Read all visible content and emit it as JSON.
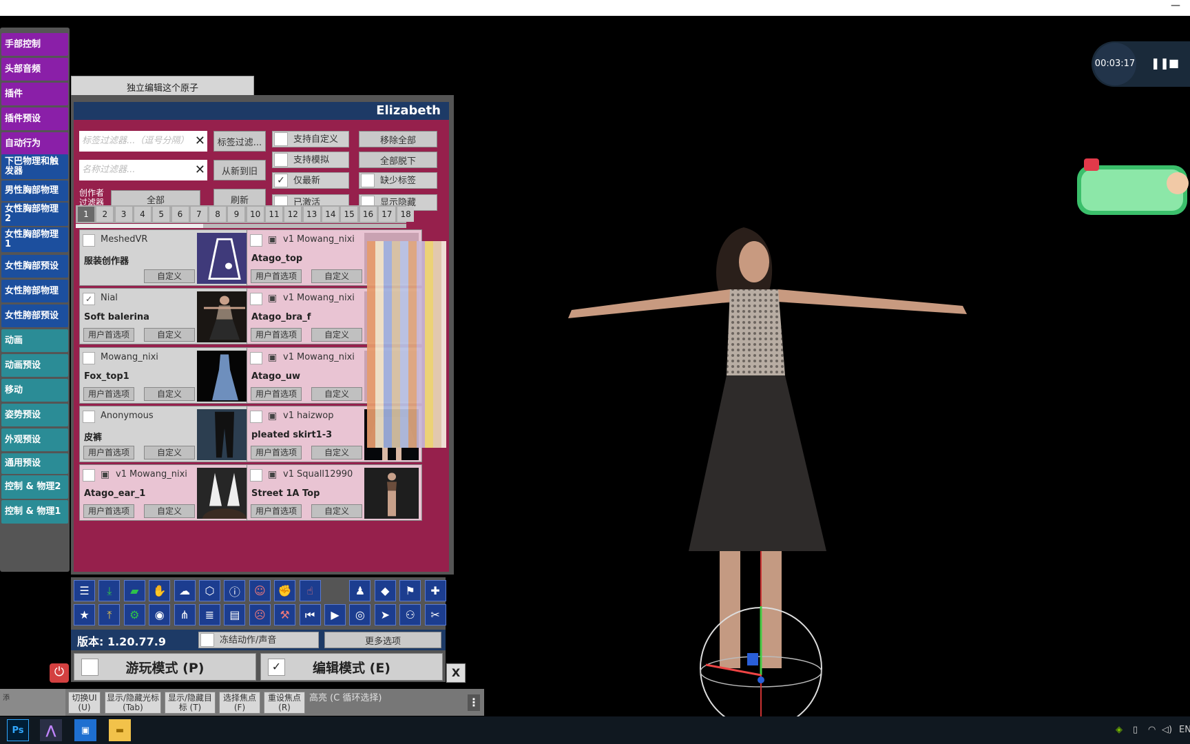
{
  "side_menu": {
    "items": [
      {
        "label": "手部控制",
        "color": "purple"
      },
      {
        "label": "头部音频",
        "color": "purple"
      },
      {
        "label": "插件",
        "color": "purple"
      },
      {
        "label": "插件预设",
        "color": "purple"
      },
      {
        "label": "自动行为",
        "color": "purple"
      },
      {
        "label": "下巴物理和触发器",
        "color": "blue"
      },
      {
        "label": "男性胸部物理",
        "color": "blue"
      },
      {
        "label": "女性胸部物理2",
        "color": "blue"
      },
      {
        "label": "女性胸部物理1",
        "color": "blue"
      },
      {
        "label": "女性胸部预设",
        "color": "blue"
      },
      {
        "label": "女性胯部物理",
        "color": "blue"
      },
      {
        "label": "女性胯部预设",
        "color": "blue"
      },
      {
        "label": "动画",
        "color": "teal"
      },
      {
        "label": "动画预设",
        "color": "teal"
      },
      {
        "label": "移动",
        "color": "teal"
      },
      {
        "label": "姿势预设",
        "color": "teal"
      },
      {
        "label": "外观预设",
        "color": "teal"
      },
      {
        "label": "通用预设",
        "color": "teal"
      },
      {
        "label": "控制 & 物理2",
        "color": "teal"
      },
      {
        "label": "控制 & 物理1",
        "color": "teal"
      }
    ]
  },
  "atom_edit_button": "独立编辑这个原子",
  "panel": {
    "title": "Elizabeth",
    "tag_filter": {
      "placeholder": "标签过滤器...（逗号分隔）",
      "clear": "✕"
    },
    "name_filter": {
      "placeholder": "名称过滤器...",
      "clear": "✕"
    },
    "tag_filter_button": "标签过滤...",
    "sort_button": "从新到旧",
    "refresh_button": "刷新",
    "creator_filter_label": "创作者过滤器",
    "creator_filter_value": "全部",
    "toggles": {
      "support_custom": {
        "label": "支持自定义",
        "checked": false
      },
      "support_sim": {
        "label": "支持模拟",
        "checked": false
      },
      "latest_only": {
        "label": "仅最新",
        "checked": true
      },
      "activated": {
        "label": "已激活",
        "checked": false
      },
      "missing_tags": {
        "label": "缺少标签",
        "checked": false
      },
      "show_hidden": {
        "label": "显示隐藏",
        "checked": false
      }
    },
    "remove_all": "移除全部",
    "undress_all": "全部脱下",
    "pages": [
      "1",
      "2",
      "3",
      "4",
      "5",
      "6",
      "7",
      "8",
      "9",
      "10",
      "11",
      "12",
      "13",
      "14",
      "15",
      "16",
      "17",
      "18"
    ],
    "current_page": "1",
    "items": [
      {
        "creator": "MeshedVR",
        "name": "服装创作器",
        "b1": "",
        "b2": "自定义",
        "version": "",
        "pkg": false,
        "pink": false,
        "thumb": "dress-icon"
      },
      {
        "creator": "Mowang_nixi",
        "name": "Atago_top",
        "b1": "用户首选项",
        "b2": "自定义",
        "version": "v1",
        "pkg": true,
        "pink": true,
        "thumb": "blurred"
      },
      {
        "creator": "Nial",
        "name": "Soft balerina",
        "b1": "用户首选项",
        "b2": "自定义",
        "version": "",
        "pkg": false,
        "pink": false,
        "thumb": "dress-photo"
      },
      {
        "creator": "Mowang_nixi",
        "name": "Atago_bra_f",
        "b1": "用户首选项",
        "b2": "自定义",
        "version": "v1",
        "pkg": true,
        "pink": true,
        "thumb": "blurred"
      },
      {
        "creator": "Mowang_nixi",
        "name": "Fox_top1",
        "b1": "用户首选项",
        "b2": "自定义",
        "version": "",
        "pkg": false,
        "pink": false,
        "thumb": "blue-gown"
      },
      {
        "creator": "Mowang_nixi",
        "name": "Atago_uw",
        "b1": "用户首选项",
        "b2": "自定义",
        "version": "v1",
        "pkg": true,
        "pink": true,
        "thumb": "blurred"
      },
      {
        "creator": "Anonymous",
        "name": "皮裤",
        "b1": "用户首选项",
        "b2": "自定义",
        "version": "",
        "pkg": false,
        "pink": false,
        "thumb": "leather-pants"
      },
      {
        "creator": "haizwop",
        "name": "pleated skirt1-3",
        "b1": "用户首选项",
        "b2": "自定义",
        "version": "v1",
        "pkg": true,
        "pink": true,
        "thumb": "skirt"
      },
      {
        "creator": "Mowang_nixi",
        "name": "Atago_ear_1",
        "b1": "用户首选项",
        "b2": "自定义",
        "version": "v1",
        "pkg": true,
        "pink": true,
        "thumb": "ears"
      },
      {
        "creator": "Squall12990",
        "name": "Street 1A Top",
        "b1": "用户首选项",
        "b2": "自定义",
        "version": "v1",
        "pkg": true,
        "pink": true,
        "thumb": "street-top"
      }
    ]
  },
  "toolbar": {
    "row1": [
      "menu-icon",
      "load-look-icon",
      "folder-icon",
      "hand-icon",
      "cloud-icon",
      "box-icon",
      "info-icon",
      "person-add-icon",
      "grab-icon",
      "touch-icon",
      "",
      "person-icon",
      "unity-icon",
      "flag-icon",
      "plus-icon"
    ],
    "row2": [
      "star-icon",
      "load-icon",
      "settings-folder-icon",
      "camera-icon",
      "nodes-icon",
      "layers-icon",
      "document-icon",
      "person-remove-icon",
      "wrench-icon",
      "skip-back-icon",
      "play-icon",
      "target-icon",
      "pointer-icon",
      "people-icon",
      "tools-icon"
    ],
    "version": "版本: 1.20.77.9",
    "freeze_label": "冻结动作/声音",
    "more_options": "更多选项"
  },
  "modes": {
    "play": {
      "label": "游玩模式 (P)",
      "checked": false
    },
    "edit": {
      "label": "编辑模式 (E)",
      "checked": true
    }
  },
  "close_label": "X",
  "bottom_bar": {
    "edge_label": "添",
    "buttons": [
      "切换UI\n(U)",
      "显示/隐藏光标\n(Tab)",
      "显示/隐藏目标 (T)",
      "选择焦点\n(F)",
      "重设焦点\n(R)"
    ],
    "hint": "高亮 (C 循环选择)"
  },
  "recording": {
    "time": "00:03:17"
  },
  "tray": {
    "lang": "EN"
  }
}
